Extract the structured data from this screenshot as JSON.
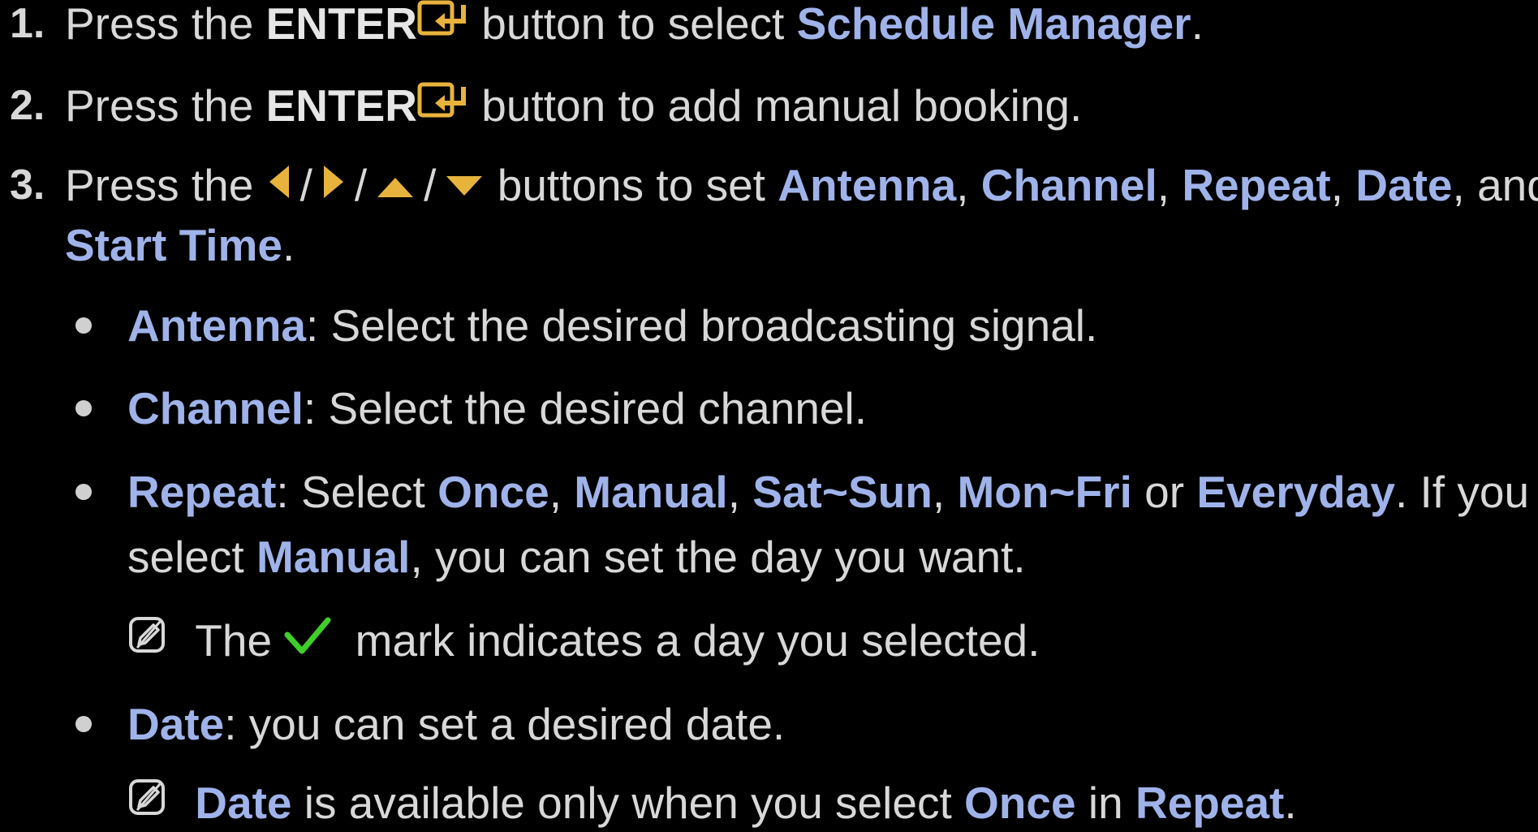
{
  "steps": [
    {
      "number": "1.",
      "lines": [
        {
          "parts": [
            "Press the ",
            "ENTER",
            " button to select ",
            "Schedule Manager",
            "."
          ]
        }
      ]
    },
    {
      "number": "2.",
      "lines": [
        {
          "parts": [
            "Press the ",
            "ENTER",
            " button to add manual booking."
          ]
        }
      ]
    },
    {
      "number": "3.",
      "lines": [
        {
          "parts": [
            "Press the ",
            "/",
            "/",
            "/",
            " buttons to set ",
            "Antenna",
            ", ",
            "Channel",
            ", ",
            "Repeat",
            ", ",
            "Date",
            ", and"
          ]
        },
        {
          "parts": [
            "Start Time",
            "."
          ]
        }
      ]
    }
  ],
  "bullets": {
    "antenna": {
      "term": "Antenna",
      "text": ": Select the desired broadcasting signal."
    },
    "channel": {
      "term": "Channel",
      "text": ": Select the desired channel."
    },
    "repeat": {
      "term": "Repeat",
      "parts": [
        ": Select ",
        "Once",
        ", ",
        "Manual",
        ", ",
        "Sat~Sun",
        ", ",
        "Mon~Fri",
        " or ",
        "Everyday",
        ". If you"
      ],
      "line2": [
        "select ",
        "Manual",
        ", you can set the day you want."
      ],
      "note": {
        "before": "The ",
        "after": " mark indicates a day you selected."
      }
    },
    "date": {
      "term": "Date",
      "text": ": you can set a desired date.",
      "note": [
        "Date",
        " is available only when you select ",
        "Once",
        " in ",
        "Repeat",
        "."
      ]
    }
  },
  "icons": {
    "enter": "enter-key-icon",
    "left": "left-arrow-icon",
    "right": "right-arrow-icon",
    "up": "up-arrow-icon",
    "down": "down-arrow-icon",
    "check": "checkmark-icon",
    "note": "note-icon"
  },
  "colors": {
    "background": "#000000",
    "text": "#d8d8d8",
    "highlight": "#9fb3ea",
    "arrow": "#e8b33c",
    "check": "#3ecf2a"
  }
}
